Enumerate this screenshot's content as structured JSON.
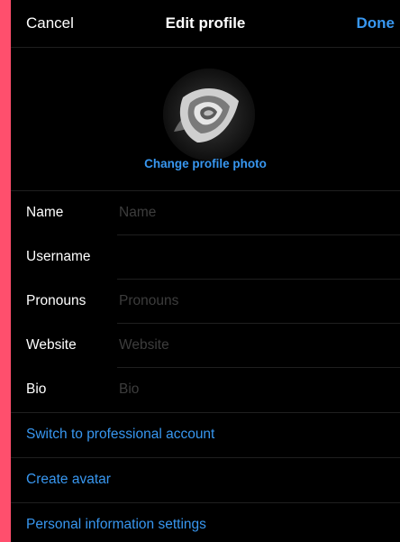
{
  "nav": {
    "cancel_label": "Cancel",
    "title": "Edit profile",
    "done_label": "Done"
  },
  "profile": {
    "change_photo_label": "Change profile photo"
  },
  "fields": [
    {
      "label": "Name",
      "placeholder": "Name"
    },
    {
      "label": "Username",
      "placeholder": ""
    },
    {
      "label": "Pronouns",
      "placeholder": "Pronouns"
    },
    {
      "label": "Website",
      "placeholder": "Website"
    },
    {
      "label": "Bio",
      "placeholder": "Bio"
    }
  ],
  "links": [
    {
      "label": "Switch to professional account"
    },
    {
      "label": "Create avatar"
    },
    {
      "label": "Personal information settings"
    }
  ],
  "colors": {
    "accent": "#3897f0",
    "background": "#000000",
    "frame": "#ff4f6d"
  }
}
